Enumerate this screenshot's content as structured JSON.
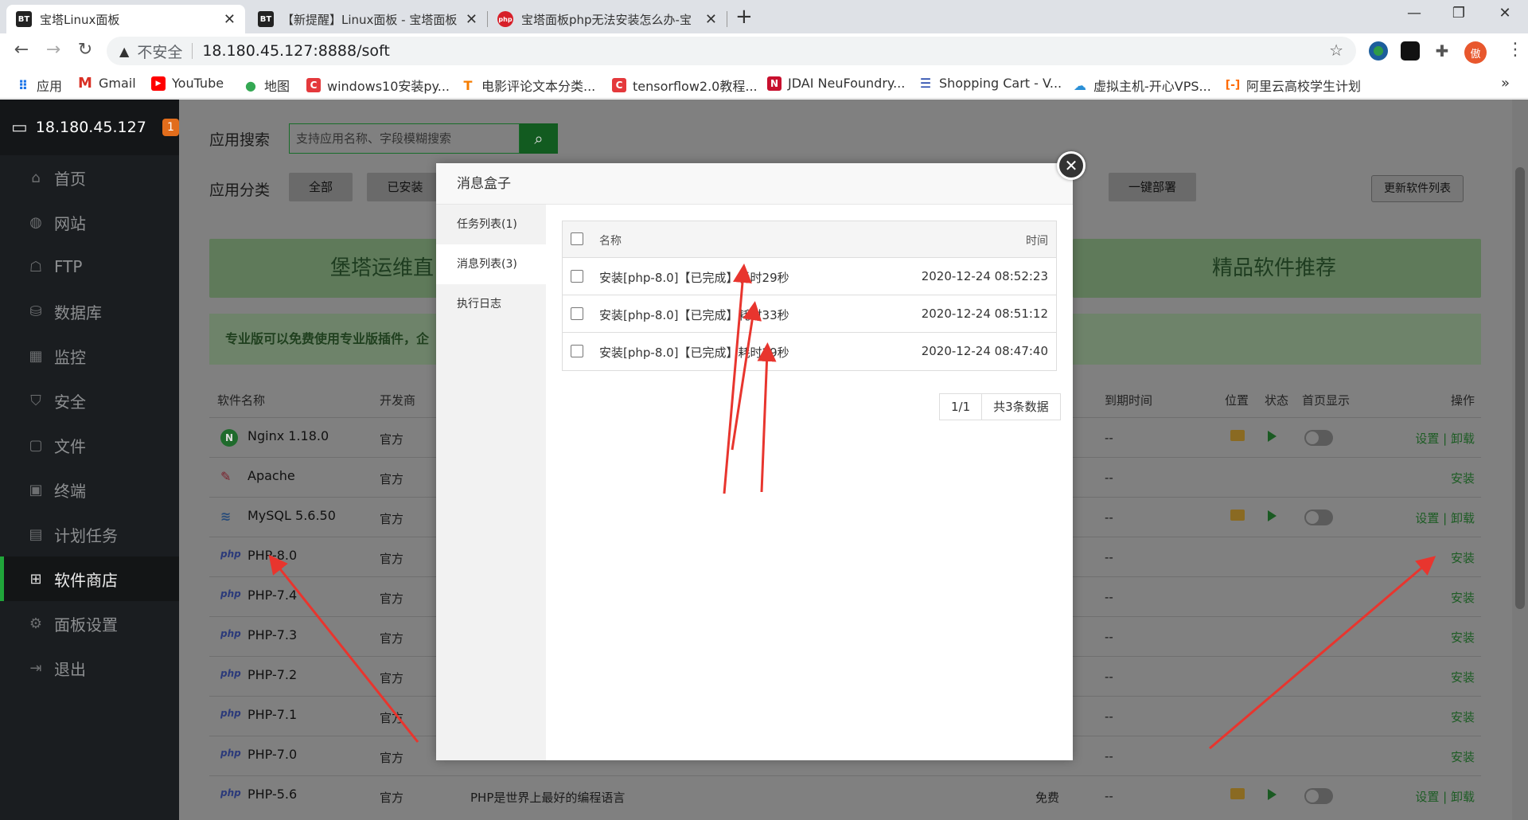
{
  "browser": {
    "tabs": [
      {
        "favicon": "BT",
        "title": "宝塔Linux面板"
      },
      {
        "favicon": "BT",
        "title": "【新提醒】Linux面板 - 宝塔面板"
      },
      {
        "favicon": "php",
        "title": "宝塔面板php无法安装怎么办-宝"
      }
    ],
    "address": {
      "security_label": "不安全",
      "url": "18.180.45.127:8888/soft"
    },
    "profile_initial": "傲",
    "bookmarks": [
      {
        "label": "应用",
        "icon": "apps-grid-icon"
      },
      {
        "label": "Gmail",
        "icon": "gmail-icon"
      },
      {
        "label": "YouTube",
        "icon": "youtube-icon"
      },
      {
        "label": "地图",
        "icon": "maps-pin-icon"
      },
      {
        "label": "windows10安装py...",
        "icon": "csdn-icon"
      },
      {
        "label": "电影评论文本分类...",
        "icon": "tensorflow-icon"
      },
      {
        "label": "tensorflow2.0教程...",
        "icon": "csdn-icon"
      },
      {
        "label": "JDAI NeuFoundry...",
        "icon": "neufoundry-icon"
      },
      {
        "label": "Shopping Cart - V...",
        "icon": "shopping-cart-icon"
      },
      {
        "label": "虚拟主机-开心VPS...",
        "icon": "vps-icon"
      },
      {
        "label": "阿里云高校学生计划",
        "icon": "aliyun-icon"
      }
    ],
    "bookmarks_more": "»"
  },
  "sidebar": {
    "server": "18.180.45.127",
    "badge": "1",
    "items": [
      {
        "label": "首页",
        "icon": "home-icon"
      },
      {
        "label": "网站",
        "icon": "globe-icon"
      },
      {
        "label": "FTP",
        "icon": "ftp-icon"
      },
      {
        "label": "数据库",
        "icon": "database-icon"
      },
      {
        "label": "监控",
        "icon": "monitor-chart-icon"
      },
      {
        "label": "安全",
        "icon": "shield-icon"
      },
      {
        "label": "文件",
        "icon": "folder-icon"
      },
      {
        "label": "终端",
        "icon": "terminal-icon"
      },
      {
        "label": "计划任务",
        "icon": "calendar-icon"
      },
      {
        "label": "软件商店",
        "icon": "grid-store-icon"
      },
      {
        "label": "面板设置",
        "icon": "gear-icon"
      },
      {
        "label": "退出",
        "icon": "logout-icon"
      }
    ],
    "active_index": 9
  },
  "store": {
    "search_label": "应用搜索",
    "search_placeholder": "支持应用名称、字段模糊搜索",
    "category_label": "应用分类",
    "categories": [
      "全部",
      "已安装",
      "一键部署"
    ],
    "refresh_label": "更新软件列表",
    "banner_left": "堡塔运维直",
    "banner_right": "精品软件推荐",
    "notice": "专业版可以免费使用专业版插件，企",
    "columns": {
      "name": "软件名称",
      "developer": "开发商",
      "expire": "到期时间",
      "location": "位置",
      "status": "状态",
      "homepage": "首页显示",
      "actions": "操作"
    },
    "rows": [
      {
        "icon": "N",
        "name": "Nginx 1.18.0",
        "dev": "官方",
        "desc": "",
        "price": "",
        "expire": "--",
        "installed": true,
        "action": "设置 | 卸载"
      },
      {
        "icon": "✎",
        "name": "Apache",
        "dev": "官方",
        "desc": "",
        "price": "",
        "expire": "--",
        "installed": false,
        "action": "安装"
      },
      {
        "icon": "≋",
        "name": "MySQL 5.6.50",
        "dev": "官方",
        "desc": "",
        "price": "",
        "expire": "--",
        "installed": true,
        "action": "设置 | 卸载"
      },
      {
        "icon": "php",
        "name": "PHP-8.0",
        "dev": "官方",
        "desc": "",
        "price": "",
        "expire": "--",
        "installed": false,
        "action": "安装"
      },
      {
        "icon": "php",
        "name": "PHP-7.4",
        "dev": "官方",
        "desc": "",
        "price": "",
        "expire": "--",
        "installed": false,
        "action": "安装"
      },
      {
        "icon": "php",
        "name": "PHP-7.3",
        "dev": "官方",
        "desc": "",
        "price": "",
        "expire": "--",
        "installed": false,
        "action": "安装"
      },
      {
        "icon": "php",
        "name": "PHP-7.2",
        "dev": "官方",
        "desc": "",
        "price": "",
        "expire": "--",
        "installed": false,
        "action": "安装"
      },
      {
        "icon": "php",
        "name": "PHP-7.1",
        "dev": "官方",
        "desc": "",
        "price": "",
        "expire": "--",
        "installed": false,
        "action": "安装"
      },
      {
        "icon": "php",
        "name": "PHP-7.0",
        "dev": "官方",
        "desc": "",
        "price": "",
        "expire": "--",
        "installed": false,
        "action": "安装"
      },
      {
        "icon": "php",
        "name": "PHP-5.6",
        "dev": "官方",
        "desc": "PHP是世界上最好的编程语言",
        "price": "免费",
        "expire": "--",
        "installed": true,
        "action": "设置 | 卸载"
      }
    ]
  },
  "modal": {
    "title": "消息盒子",
    "close_icon": "close-icon",
    "nav": [
      "任务列表(1)",
      "消息列表(3)",
      "执行日志"
    ],
    "active_nav": 1,
    "columns": {
      "name": "名称",
      "time": "时间"
    },
    "messages": [
      {
        "name": "安装[php-8.0]【已完成】耗时29秒",
        "time": "2020-12-24 08:52:23"
      },
      {
        "name": "安装[php-8.0]【已完成】耗时33秒",
        "time": "2020-12-24 08:51:12"
      },
      {
        "name": "安装[php-8.0]【已完成】耗时29秒",
        "time": "2020-12-24 08:47:40"
      }
    ],
    "pager": {
      "page": "1/1",
      "total": "共3条数据"
    }
  },
  "annotation_color": "#e8352e"
}
